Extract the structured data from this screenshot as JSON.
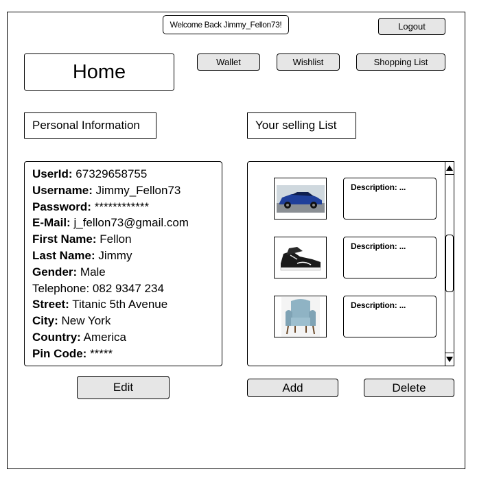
{
  "header": {
    "welcome_text": "Welcome Back Jimmy_Fellon73!",
    "logout_label": "Logout"
  },
  "page_title": "Home",
  "nav": {
    "wallet_label": "Wallet",
    "wishlist_label": "Wishlist",
    "shopping_list_label": "Shopping List"
  },
  "personal": {
    "title": "Personal Information",
    "rows": [
      {
        "label": "UserId:",
        "value": " 67329658755",
        "bold": true
      },
      {
        "label": "Username:",
        "value": " Jimmy_Fellon73",
        "bold": true
      },
      {
        "label": "Password:",
        "value": " ************",
        "bold": true
      },
      {
        "label": "E-Mail:",
        "value": " j_fellon73@gmail.com",
        "bold": true
      },
      {
        "label": "First Name:",
        "value": " Fellon",
        "bold": true
      },
      {
        "label": "Last Name:",
        "value": " Jimmy",
        "bold": true
      },
      {
        "label": "Gender:",
        "value": " Male",
        "bold": true
      },
      {
        "label": "Telephone:",
        "value": " 082 9347 234",
        "bold": false
      },
      {
        "label": "Street:",
        "value": " Titanic 5th Avenue",
        "bold": true
      },
      {
        "label": "City:",
        "value": " New York",
        "bold": true
      },
      {
        "label": "Country:",
        "value": " America",
        "bold": true
      },
      {
        "label": "Pin Code:",
        "value": " *****",
        "bold": true
      }
    ],
    "edit_label": "Edit"
  },
  "selling": {
    "title": "Your selling List",
    "items": [
      {
        "image": "car-image",
        "description": "Description: ..."
      },
      {
        "image": "sneaker-image",
        "description": "Description: ..."
      },
      {
        "image": "armchair-image",
        "description": "Description: ..."
      }
    ],
    "add_label": "Add",
    "delete_label": "Delete"
  },
  "colors": {
    "button_fill": "#e6e6e6",
    "border": "#000000",
    "car_blue": "#1f3f9a",
    "chair_blue": "#8fb3c4"
  }
}
